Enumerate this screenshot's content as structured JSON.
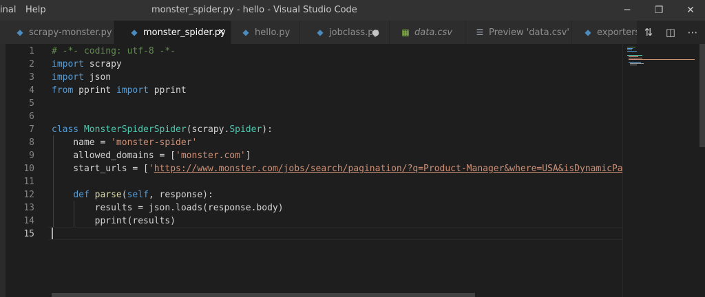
{
  "titlebar": {
    "menu": [
      "inal",
      "Help"
    ],
    "title": "monster_spider.py - hello - Visual Studio Code",
    "controls": {
      "minimize": "─",
      "restore": "❐",
      "close": "✕"
    }
  },
  "tabs": [
    {
      "label": "scrapy-monster.py",
      "icon": "python-file-icon",
      "active": false
    },
    {
      "label": "monster_spider.py",
      "icon": "python-file-icon",
      "active": true,
      "close": "×"
    },
    {
      "label": "hello.py",
      "icon": "python-file-icon",
      "active": false
    },
    {
      "label": "jobclass.py",
      "icon": "python-file-icon",
      "active": false,
      "dirty": "●"
    },
    {
      "label": "data.csv",
      "icon": "csv-file-icon",
      "active": false
    },
    {
      "label": "Preview 'data.csv'",
      "icon": "preview-icon",
      "active": false
    },
    {
      "label": "exporters.",
      "icon": "python-file-icon",
      "active": false
    }
  ],
  "tab_actions": {
    "compare": "⇅",
    "split": "◫",
    "more": "⋯"
  },
  "editor": {
    "current_line": 15,
    "lines": [
      {
        "n": "1",
        "t": [
          {
            "c": "cm",
            "s": "# -*- coding: utf-8 -*-"
          }
        ]
      },
      {
        "n": "2",
        "t": [
          {
            "c": "kw",
            "s": "import"
          },
          {
            "c": "",
            "s": " scrapy"
          }
        ]
      },
      {
        "n": "3",
        "t": [
          {
            "c": "kw",
            "s": "import"
          },
          {
            "c": "",
            "s": " json"
          }
        ]
      },
      {
        "n": "4",
        "t": [
          {
            "c": "kw",
            "s": "from"
          },
          {
            "c": "",
            "s": " pprint "
          },
          {
            "c": "kw",
            "s": "import"
          },
          {
            "c": "",
            "s": " pprint"
          }
        ]
      },
      {
        "n": "5",
        "t": []
      },
      {
        "n": "6",
        "t": []
      },
      {
        "n": "7",
        "t": [
          {
            "c": "kw",
            "s": "class"
          },
          {
            "c": "",
            "s": " "
          },
          {
            "c": "cls",
            "s": "MonsterSpiderSpider"
          },
          {
            "c": "",
            "s": "(scrapy."
          },
          {
            "c": "cls",
            "s": "Spider"
          },
          {
            "c": "",
            "s": "):"
          }
        ]
      },
      {
        "n": "8",
        "t": [
          {
            "c": "",
            "s": "    name = "
          },
          {
            "c": "str",
            "s": "'monster-spider'"
          }
        ]
      },
      {
        "n": "9",
        "t": [
          {
            "c": "",
            "s": "    allowed_domains = ["
          },
          {
            "c": "str",
            "s": "'monster.com'"
          },
          {
            "c": "",
            "s": "]"
          }
        ]
      },
      {
        "n": "10",
        "t": [
          {
            "c": "",
            "s": "    start_urls = ["
          },
          {
            "c": "str",
            "s": "'"
          },
          {
            "c": "url",
            "s": "https://www.monster.com/jobs/search/pagination/?q=Product-Manager&where=USA&isDynamicPage"
          }
        ]
      },
      {
        "n": "11",
        "t": []
      },
      {
        "n": "12",
        "t": [
          {
            "c": "",
            "s": "    "
          },
          {
            "c": "kw",
            "s": "def"
          },
          {
            "c": "",
            "s": " "
          },
          {
            "c": "fn",
            "s": "parse"
          },
          {
            "c": "",
            "s": "("
          },
          {
            "c": "kw",
            "s": "self"
          },
          {
            "c": "",
            "s": ", response):"
          }
        ]
      },
      {
        "n": "13",
        "t": [
          {
            "c": "",
            "s": "        results = json.loads(response.body)"
          }
        ]
      },
      {
        "n": "14",
        "t": [
          {
            "c": "",
            "s": "        pprint(results)"
          }
        ]
      },
      {
        "n": "15",
        "t": []
      }
    ]
  },
  "colors": {
    "editor_bg": "#1e1e1e",
    "keyword": "#569cd6",
    "string": "#ce9178",
    "comment": "#608b4e",
    "class": "#4ec9b0"
  }
}
